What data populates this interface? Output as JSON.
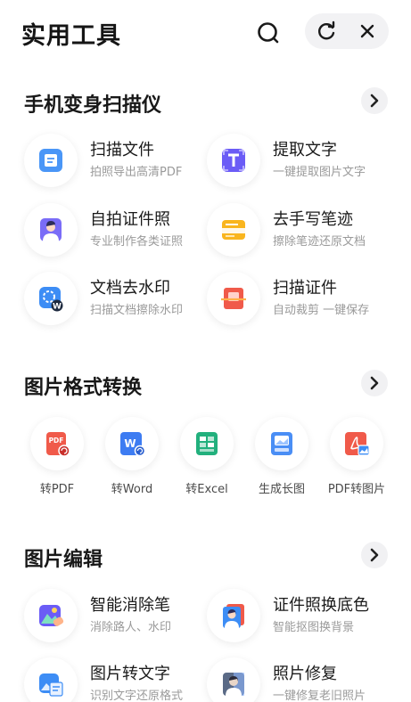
{
  "header": {
    "title": "实用工具"
  },
  "sections": {
    "scan": {
      "title": "手机变身扫描仪",
      "items": [
        {
          "name": "扫描文件",
          "desc": "拍照导出高清PDF",
          "icon": "scan-file-icon"
        },
        {
          "name": "提取文字",
          "desc": "一键提取图片文字",
          "icon": "text-extract-icon"
        },
        {
          "name": "自拍证件照",
          "desc": "专业制作各类证照",
          "icon": "id-photo-icon"
        },
        {
          "name": "去手写笔迹",
          "desc": "擦除笔迹还原文档",
          "icon": "handwriting-remove-icon"
        },
        {
          "name": "文档去水印",
          "desc": "扫描文档擦除水印",
          "icon": "watermark-remove-icon"
        },
        {
          "name": "扫描证件",
          "desc": "自动裁剪 一键保存",
          "icon": "scan-id-icon"
        }
      ]
    },
    "convert": {
      "title": "图片格式转换",
      "items": [
        {
          "label": "转PDF",
          "icon": "pdf-icon"
        },
        {
          "label": "转Word",
          "icon": "word-icon"
        },
        {
          "label": "转Excel",
          "icon": "excel-icon"
        },
        {
          "label": "生成长图",
          "icon": "long-image-icon"
        },
        {
          "label": "PDF转图片",
          "icon": "pdf-to-image-icon"
        }
      ]
    },
    "edit": {
      "title": "图片编辑",
      "items": [
        {
          "name": "智能消除笔",
          "desc": "消除路人、水印",
          "icon": "smart-eraser-icon"
        },
        {
          "name": "证件照换底色",
          "desc": "智能抠图换背景",
          "icon": "background-change-icon"
        },
        {
          "name": "图片转文字",
          "desc": "识别文字还原格式",
          "icon": "image-to-text-icon"
        },
        {
          "name": "照片修复",
          "desc": "一键修复老旧照片",
          "icon": "photo-restore-icon"
        }
      ]
    }
  },
  "colors": {
    "blue": "#3d8df5",
    "purple": "#6b5cf6",
    "yellow": "#f9b51e",
    "red": "#f05a4a",
    "green": "#22b07d",
    "text_primary": "#1a1a1a",
    "text_secondary": "#9a9a9a"
  }
}
